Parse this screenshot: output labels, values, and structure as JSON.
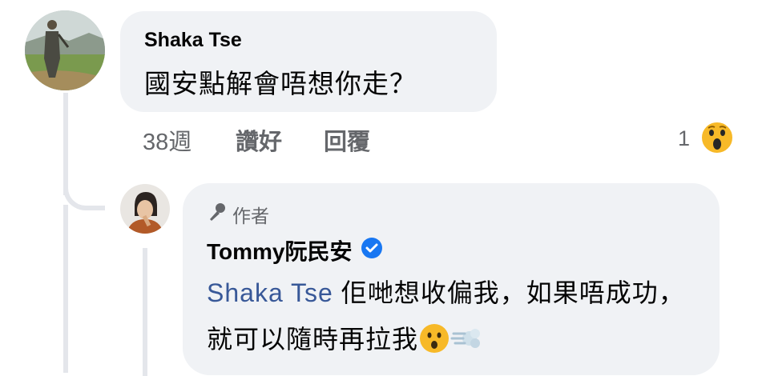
{
  "comment": {
    "author": "Shaka Tse",
    "text": "國安點解會唔想你走？",
    "time": "38週",
    "like_label": "讚好",
    "reply_label": "回覆",
    "reaction_count": "1",
    "reaction_icon": "wow-emoji-icon"
  },
  "reply": {
    "badge_label": "作者",
    "author": "Tommy阮民安",
    "mention": "Shaka Tse",
    "text_part1": " 佢哋想收偏我，如果唔成功，就可以隨時再拉我",
    "emojis": [
      "astonished-emoji-icon",
      "dash-emoji-icon"
    ]
  },
  "colors": {
    "bubble_bg": "#f0f2f5",
    "mention_color": "#385898",
    "meta_color": "#65676b",
    "verified_blue": "#1877f2"
  }
}
